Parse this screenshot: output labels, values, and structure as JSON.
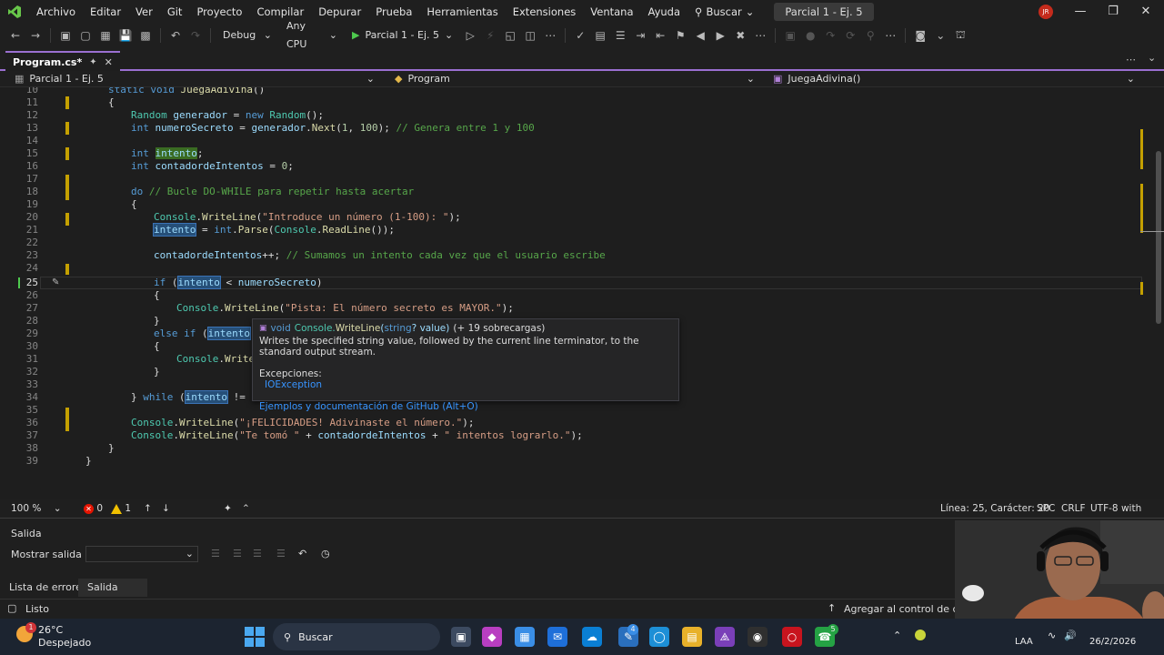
{
  "menu": {
    "items": [
      "Archivo",
      "Editar",
      "Ver",
      "Git",
      "Proyecto",
      "Compilar",
      "Depurar",
      "Prueba",
      "Herramientas",
      "Extensiones",
      "Ventana",
      "Ayuda"
    ],
    "search": "Buscar",
    "solution_title": "Parcial 1 - Ej. 5",
    "user_initials": "JR"
  },
  "toolbar": {
    "config": "Debug",
    "platform": "Any CPU",
    "run_target": "Parcial 1 - Ej. 5"
  },
  "tab": {
    "label": "Program.cs*"
  },
  "nav": {
    "project": "Parcial 1 - Ej. 5",
    "class": "Program",
    "member": "JuegaAdivina()"
  },
  "code": {
    "line_numbers": [
      "10",
      "11",
      "12",
      "13",
      "14",
      "15",
      "16",
      "17",
      "18",
      "19",
      "20",
      "21",
      "22",
      "23",
      "24",
      "25",
      "26",
      "27",
      "28",
      "29",
      "30",
      "31",
      "32",
      "33",
      "34",
      "35",
      "36",
      "37",
      "38",
      "39"
    ]
  },
  "tooltip": {
    "kw_void": "void",
    "class": "Console.",
    "method": "WriteLine",
    "param_type": "string",
    "param_rest": "? value)",
    "overloads": "(+ 19 sobrecargas)",
    "description": "Writes the specified string value, followed by the current line terminator, to the standard output stream.",
    "exceptions_label": "Excepciones:",
    "exception": "IOException",
    "examples_link": "Ejemplos y documentación de GitHub (Alt+O)"
  },
  "editor_status": {
    "zoom": "100 %",
    "errors": "0",
    "warnings": "1",
    "position": "Línea: 25, Carácter: 20",
    "whitespace": "SPC",
    "line_ending": "CRLF",
    "encoding": "UTF-8 with BOM"
  },
  "output": {
    "title": "Salida",
    "show_output_label": "Mostrar salida de:"
  },
  "bottom_tabs": [
    "Lista de errores",
    "Salida"
  ],
  "statusbar": {
    "ready": "Listo",
    "source_control": "Agregar al control de códig"
  },
  "taskbar": {
    "weather_temp": "26°C",
    "weather_desc": "Despejado",
    "search": "Buscar",
    "language": "LAA",
    "date": "26/2/2026",
    "badge_weather": "1",
    "badge_app": "4",
    "badge_whatsapp": "5"
  },
  "colors": {
    "accent": "#9a6fd1",
    "run_green": "#4ec94e",
    "error_red": "#e51400",
    "warning_yellow": "#f0c000",
    "taskbar": "#1c2430"
  }
}
